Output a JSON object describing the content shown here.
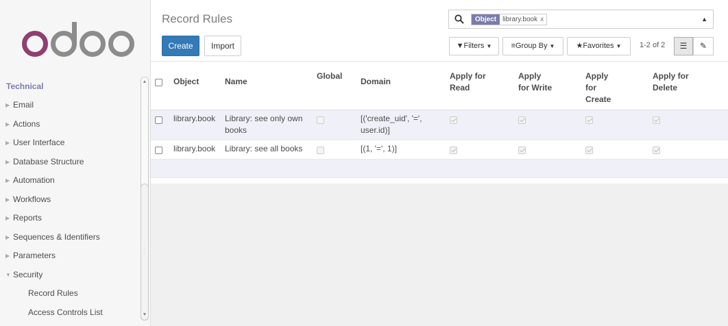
{
  "brand": {
    "logo_text": "odoo",
    "logo_color": "#8f3f71"
  },
  "sidebar": {
    "section": "Technical",
    "items": [
      {
        "label": "Email"
      },
      {
        "label": "Actions"
      },
      {
        "label": "User Interface"
      },
      {
        "label": "Database Structure"
      },
      {
        "label": "Automation"
      },
      {
        "label": "Workflows"
      },
      {
        "label": "Reports"
      },
      {
        "label": "Sequences & Identifiers"
      },
      {
        "label": "Parameters"
      },
      {
        "label": "Security",
        "expanded": true
      }
    ],
    "sub_items": [
      {
        "label": "Record Rules"
      },
      {
        "label": "Access Controls List"
      }
    ]
  },
  "header": {
    "title": "Record Rules",
    "create_label": "Create",
    "import_label": "Import"
  },
  "search": {
    "facet_category": "Object",
    "facet_value": "library.book",
    "facet_remove": "x"
  },
  "toolbar": {
    "filters_label": "Filters",
    "group_by_label": "Group By",
    "favorites_label": "Favorites",
    "pager": "1-2 of 2"
  },
  "table": {
    "columns": [
      "Object",
      "Name",
      "Global",
      "Domain",
      "Apply for Read",
      "Apply for Write",
      "Apply for Create",
      "Apply for Delete"
    ],
    "rows": [
      {
        "object": "library.book",
        "name": "Library: see only own books",
        "global": false,
        "domain": "[('create_uid', '=', user.id)]",
        "read": true,
        "write": true,
        "create": true,
        "delete": true
      },
      {
        "object": "library.book",
        "name": "Library: see all books",
        "global": false,
        "domain": "[(1, '=', 1)]",
        "read": true,
        "write": true,
        "create": true,
        "delete": true
      }
    ]
  },
  "colors": {
    "primary": "#337ab7",
    "accent": "#7c7bad",
    "row_stripe": "#f0f0f8"
  }
}
